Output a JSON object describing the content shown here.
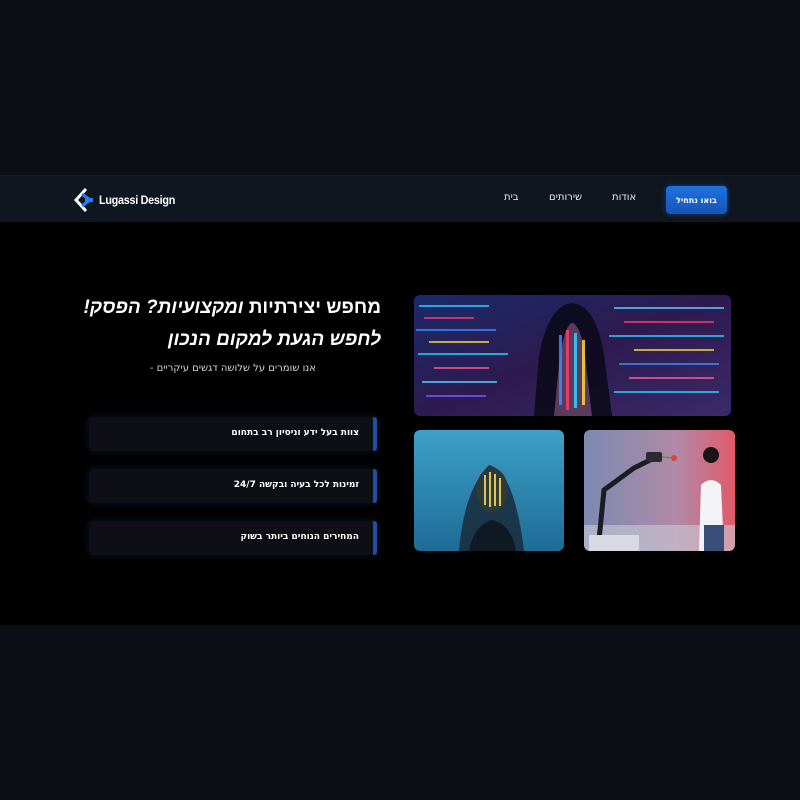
{
  "brand": {
    "name": "Lugassi Design"
  },
  "nav": {
    "items": [
      {
        "label": "בית"
      },
      {
        "label": "שירותים"
      },
      {
        "label": "אודות"
      }
    ],
    "cta_label": "בואו נתחיל"
  },
  "hero": {
    "headline_line1_part1": "מחפש יצירתיות ",
    "headline_line1_emph": "ומקצועיות? הפסק!",
    "headline_line2": "לחפש הגעת למקום הנכון",
    "subtitle": "אנו שומרים על שלושה דגשים עיקריים -",
    "features": [
      {
        "text": "צוות בעל ידע וניסיון רב בתחום"
      },
      {
        "text": "זמינות לכל בעיה ובקשה 24/7"
      },
      {
        "text": "המחירים הנוחים ביותר בשוק"
      }
    ],
    "images": [
      {
        "name": "woman-code-projection-image"
      },
      {
        "name": "girl-blue-projection-image"
      },
      {
        "name": "woman-robot-arm-image"
      }
    ]
  },
  "colors": {
    "page_bg": "#0b0e15",
    "navbar_bg": "#0f1620",
    "hero_bg": "#000000",
    "accent": "#1f72e0"
  },
  "icons": {
    "logo": "lugassi-logo-icon"
  }
}
